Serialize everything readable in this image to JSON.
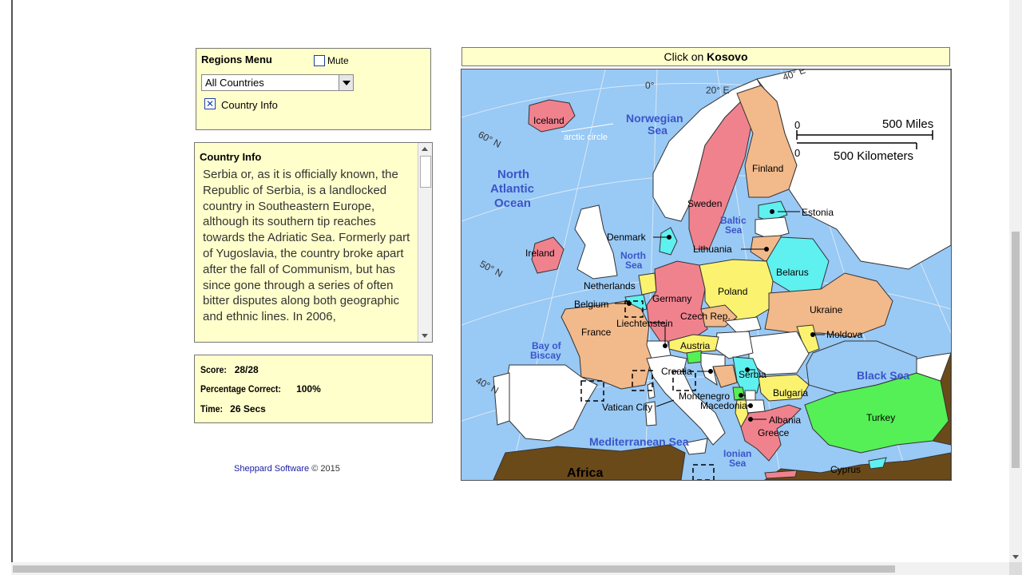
{
  "regions_menu": {
    "title": "Regions Menu",
    "mute_label": "Mute",
    "mute_checked": false,
    "selected_region": "All Countries",
    "country_info_label": "Country Info",
    "country_info_checked": true
  },
  "country_info": {
    "title": "Country Info",
    "text": "Serbia or, as it is officially known, the Republic of Serbia, is a landlocked country in Southeastern Europe, although its southern tip reaches towards the Adriatic Sea. Formerly part of Yugoslavia, the country broke apart after the fall of Communism, but has since gone through a series of often bitter disputes along both geographic and ethnic lines. In 2006,"
  },
  "score": {
    "score_label": "Score:",
    "score_value": "28/28",
    "percent_label": "Percentage Correct:",
    "percent_value": "100%",
    "time_label": "Time:",
    "time_value": "26 Secs"
  },
  "footer": {
    "company": "Sheppard Software",
    "copyright": "© 2015"
  },
  "prompt": {
    "prefix": "Click on ",
    "target": "Kosovo"
  },
  "map": {
    "colors": {
      "water": "#99c9f5",
      "unselected_land": "#ffffff",
      "pink": "#f0828e",
      "tan": "#f2b98a",
      "yellow": "#fbf270",
      "cyan": "#5ff0f0",
      "green": "#55f055",
      "brown": "#6b4a1a"
    },
    "degree_labels": [
      "0°",
      "20° E",
      "40° E",
      "60° N",
      "50° N",
      "40° N"
    ],
    "scale": {
      "zero_top": "0",
      "miles": "500 Miles",
      "zero_bottom": "0",
      "kilometers": "500 Kilometers"
    },
    "seas": [
      "Norwegian",
      "Sea",
      "North",
      "Atlantic",
      "Ocean",
      "Baltic",
      "Sea",
      "North",
      "Sea",
      "Bay of",
      "Biscay",
      "Black Sea",
      "Mediterranean Sea",
      "Ionian",
      "Sea"
    ],
    "annotations": {
      "arctic_circle": "arctic circle",
      "africa": "Africa"
    },
    "countries": [
      "Iceland",
      "Sweden",
      "Finland",
      "Estonia",
      "Denmark",
      "Lithuania",
      "Ireland",
      "Belarus",
      "Poland",
      "Netherlands",
      "Germany",
      "Belgium",
      "Ukraine",
      "Liechtenstein",
      "Czech Rep.",
      "France",
      "Moldova",
      "Austria",
      "Croatia",
      "Serbia",
      "Bulgaria",
      "Montenegro",
      "Vatican City",
      "Macedonia",
      "Albania",
      "Turkey",
      "Greece",
      "Cyprus"
    ]
  }
}
